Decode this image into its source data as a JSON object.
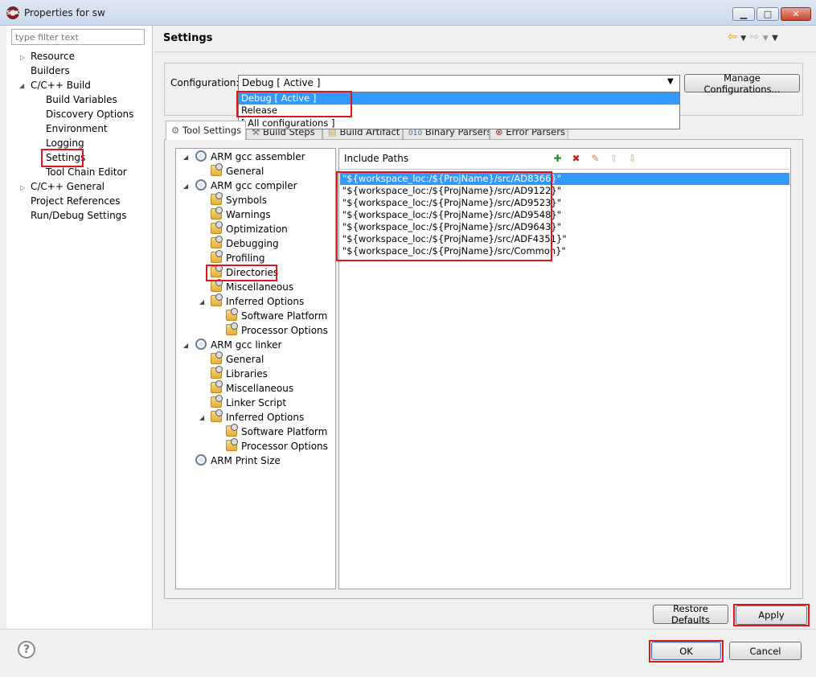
{
  "window": {
    "title": "Properties for sw",
    "min_icon": "minimize-icon",
    "max_icon": "maximize-icon",
    "close_icon": "close-icon"
  },
  "filter": {
    "placeholder": "type filter text"
  },
  "nav": {
    "resource": "Resource",
    "builders": "Builders",
    "cc_build": "C/C++ Build",
    "build_variables": "Build Variables",
    "discovery_options": "Discovery Options",
    "environment": "Environment",
    "logging": "Logging",
    "settings": "Settings",
    "tool_chain_editor": "Tool Chain Editor",
    "cc_general": "C/C++ General",
    "project_references": "Project References",
    "run_debug": "Run/Debug Settings"
  },
  "page_title": "Settings",
  "configuration": {
    "label": "Configuration:",
    "selected": "Debug  [ Active ]",
    "manage_button": "Manage Configurations...",
    "options": [
      "Debug  [ Active ]",
      "Release",
      "[ All configurations ]"
    ]
  },
  "tabs": [
    "Tool Settings",
    "Build Steps",
    "Build Artifact",
    "Binary Parsers",
    "Error Parsers"
  ],
  "tree": {
    "assembler": "ARM gcc assembler",
    "asm_general": "General",
    "compiler": "ARM gcc compiler",
    "symbols": "Symbols",
    "warnings": "Warnings",
    "optimization": "Optimization",
    "debugging": "Debugging",
    "profiling": "Profiling",
    "directories": "Directories",
    "miscellaneous": "Miscellaneous",
    "inferred_options": "Inferred Options",
    "software_platform": "Software Platform",
    "processor_options": "Processor Options",
    "linker": "ARM gcc linker",
    "lnk_general": "General",
    "libraries": "Libraries",
    "lnk_miscellaneous": "Miscellaneous",
    "linker_script": "Linker Script",
    "lnk_inferred_options": "Inferred Options",
    "lnk_software_platform": "Software Platform",
    "lnk_processor_options": "Processor Options",
    "print_size": "ARM Print Size"
  },
  "include_paths": {
    "label": "Include Paths",
    "toolbar_icons": [
      "add-icon",
      "delete-icon",
      "edit-icon",
      "move-up-icon",
      "move-down-icon"
    ],
    "items": [
      "\"${workspace_loc:/${ProjName}/src/AD8366}\"",
      "\"${workspace_loc:/${ProjName}/src/AD9122}\"",
      "\"${workspace_loc:/${ProjName}/src/AD9523}\"",
      "\"${workspace_loc:/${ProjName}/src/AD9548}\"",
      "\"${workspace_loc:/${ProjName}/src/AD9643}\"",
      "\"${workspace_loc:/${ProjName}/src/ADF4351}\"",
      "\"${workspace_loc:/${ProjName}/src/Common}\""
    ]
  },
  "buttons": {
    "restore_defaults": "Restore Defaults",
    "apply": "Apply",
    "ok": "OK",
    "cancel": "Cancel"
  },
  "colors": {
    "selection": "#3399ff",
    "highlight_box": "#e0161f"
  }
}
